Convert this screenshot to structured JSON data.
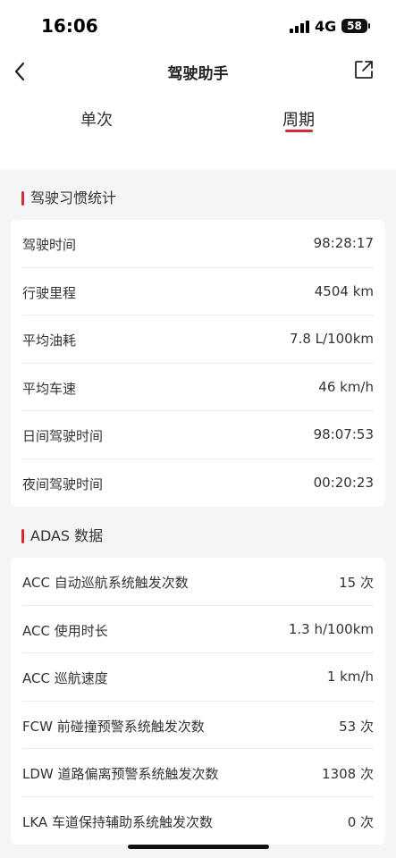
{
  "status_bar": {
    "time": "16:06",
    "network": "4G",
    "battery": "58"
  },
  "header": {
    "title": "驾驶助手",
    "back_icon": "chevron-left-icon",
    "share_icon": "external-link-icon"
  },
  "tabs": [
    {
      "label": "单次",
      "active": false
    },
    {
      "label": "周期",
      "active": true
    }
  ],
  "colors": {
    "accent": "#d62b36",
    "background": "#f4f5f7",
    "card": "#ffffff"
  },
  "habits": {
    "title": "驾驶习惯统计",
    "rows": [
      {
        "label": "驾驶时间",
        "value": "98:28:17"
      },
      {
        "label": "行驶里程",
        "value": "4504 km"
      },
      {
        "label": "平均油耗",
        "value": "7.8 L/100km"
      },
      {
        "label": "平均车速",
        "value": "46 km/h"
      },
      {
        "label": "日间驾驶时间",
        "value": "98:07:53"
      },
      {
        "label": "夜间驾驶时间",
        "value": "00:20:23"
      }
    ]
  },
  "adas": {
    "title": "ADAS 数据",
    "rows": [
      {
        "label": "ACC 自动巡航系统触发次数",
        "value": "15 次"
      },
      {
        "label": "ACC 使用时长",
        "value": "1.3 h/100km"
      },
      {
        "label": "ACC 巡航速度",
        "value": "1 km/h"
      },
      {
        "label": "FCW 前碰撞预警系统触发次数",
        "value": "53 次"
      },
      {
        "label": "LDW 道路偏离预警系统触发次数",
        "value": "1308 次"
      },
      {
        "label": "LKA 车道保持辅助系统触发次数",
        "value": "0 次"
      }
    ]
  }
}
